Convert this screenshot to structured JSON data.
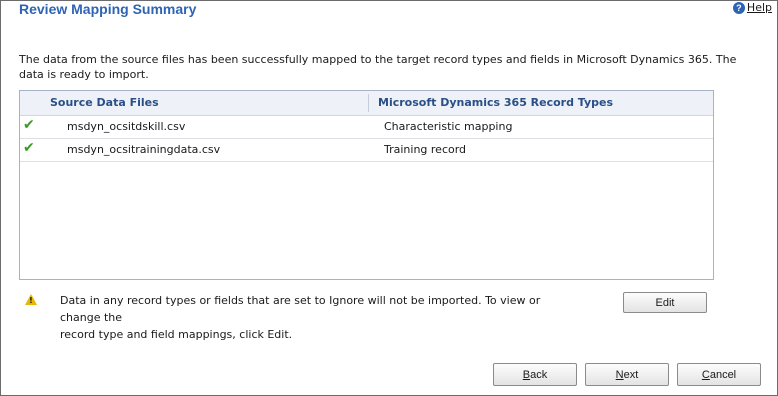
{
  "header": {
    "title": "Review Mapping Summary",
    "help_label": "Help",
    "help_icon": "question-circle-icon"
  },
  "description": "The data from the source files has been successfully mapped to the target record types and fields in Microsoft Dynamics 365. The data is ready to import.",
  "grid": {
    "columns": [
      "Source Data Files",
      "Microsoft Dynamics 365 Record Types"
    ],
    "rows": [
      {
        "status_icon": "checkmark-icon",
        "source": "msdyn_ocsitdskill.csv",
        "record_type": "Characteristic mapping"
      },
      {
        "status_icon": "checkmark-icon",
        "source": "msdyn_ocsitrainingdata.csv",
        "record_type": "Training record"
      }
    ]
  },
  "warning": {
    "icon": "warning-icon",
    "text_line1": "Data in any record types or fields that are set to Ignore will not be imported. To view or change the",
    "text_line2": "record type and field mappings, click Edit."
  },
  "buttons": {
    "edit": "Edit",
    "back_first": "B",
    "back_rest": "ack",
    "next_first": "N",
    "next_rest": "ext",
    "cancel_first": "C",
    "cancel_rest": "ancel"
  },
  "colors": {
    "accent": "#2e64b4",
    "check": "#3a9a25",
    "warning": "#e8b800"
  }
}
